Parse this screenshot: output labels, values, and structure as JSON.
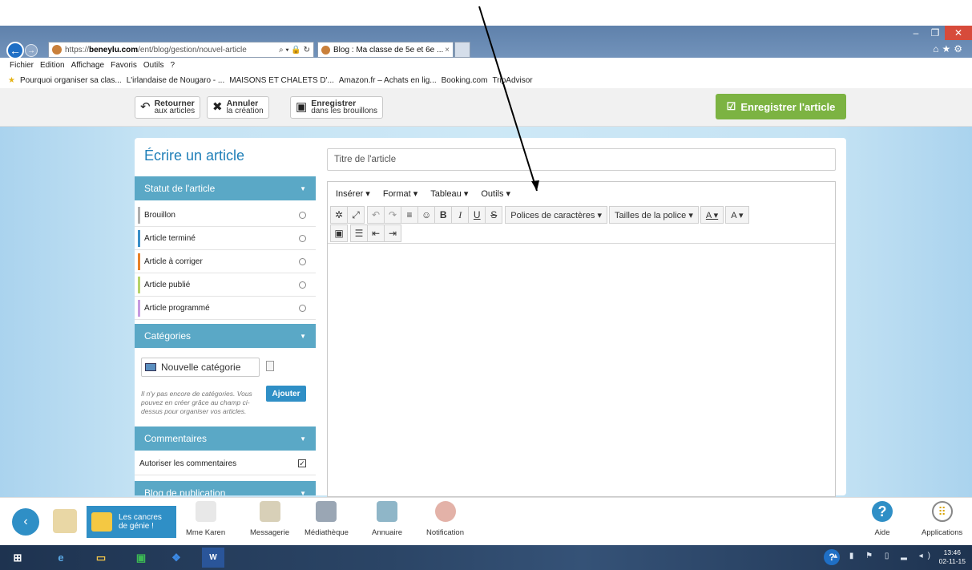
{
  "browser": {
    "url_prefix": "https://",
    "url_host": "beneylu.com",
    "url_path": "/ent/blog/gestion/nouvel-article",
    "address_controls": "⌕ ▾ 🔒 ↻",
    "tab_title": "Blog : Ma classe de 5e et 6e ...",
    "tab_close": "×",
    "menu": [
      "Fichier",
      "Edition",
      "Affichage",
      "Favoris",
      "Outils",
      "?"
    ],
    "favorites": [
      "Pourquoi organiser sa clas...",
      "L'irlandaise de Nougaro - ...",
      "MAISONS ET CHALETS D'...",
      "Amazon.fr – Achats en lig...",
      "Booking.com",
      "TripAdvisor"
    ],
    "right_icons": "⌂★⚙"
  },
  "toolbar": {
    "back_line1": "Retourner",
    "back_line2": "aux articles",
    "cancel_line1": "Annuler",
    "cancel_line2": "la création",
    "draft_line1": "Enregistrer",
    "draft_line2": "dans les brouillons",
    "save_article": "Enregistrer l'article"
  },
  "left_panel": {
    "title": "Écrire un article",
    "status_header": "Statut de l'article",
    "statuses": [
      {
        "label": "Brouillon",
        "color": "#b0b0b0"
      },
      {
        "label": "Article terminé",
        "color": "#3a8fc8"
      },
      {
        "label": "Article à corriger",
        "color": "#e8822a"
      },
      {
        "label": "Article publié",
        "color": "#b7d36a"
      },
      {
        "label": "Article programmé",
        "color": "#c79be0"
      }
    ],
    "categories_header": "Catégories",
    "category_input_value": "Nouvelle catégorie",
    "no_category_text": "Il n'y pas encore de catégories. Vous pouvez en créer grâce au champ ci-dessus pour organiser vos articles.",
    "add_button": "Ajouter",
    "comments_header": "Commentaires",
    "allow_comments": "Autoriser les commentaires",
    "allow_comments_checked": "✓",
    "blog_header": "Blog de publication"
  },
  "editor": {
    "title_placeholder": "Titre de l'article",
    "menu": [
      "Insérer ▾",
      "Format ▾",
      "Tableau ▾",
      "Outils ▾"
    ],
    "font_family_label": "Polices de caractères ▾",
    "font_size_label": "Tailles de la police ▾",
    "text_color_label": "A ▾",
    "bg_color_label": "A ▾"
  },
  "dock": {
    "group_name_line1": "Les cancres",
    "group_name_line2": "de génie !",
    "items": [
      "Mme Karen",
      "Messagerie",
      "Médiathèque",
      "Annuaire",
      "Notification"
    ],
    "help": "Aide",
    "apps": "Applications"
  },
  "taskbar": {
    "time": "13:46",
    "date": "02-11-15"
  },
  "colors": {
    "accent": "#5aa8c6",
    "save_green": "#7cb342",
    "brand_blue": "#2f8fc6"
  }
}
